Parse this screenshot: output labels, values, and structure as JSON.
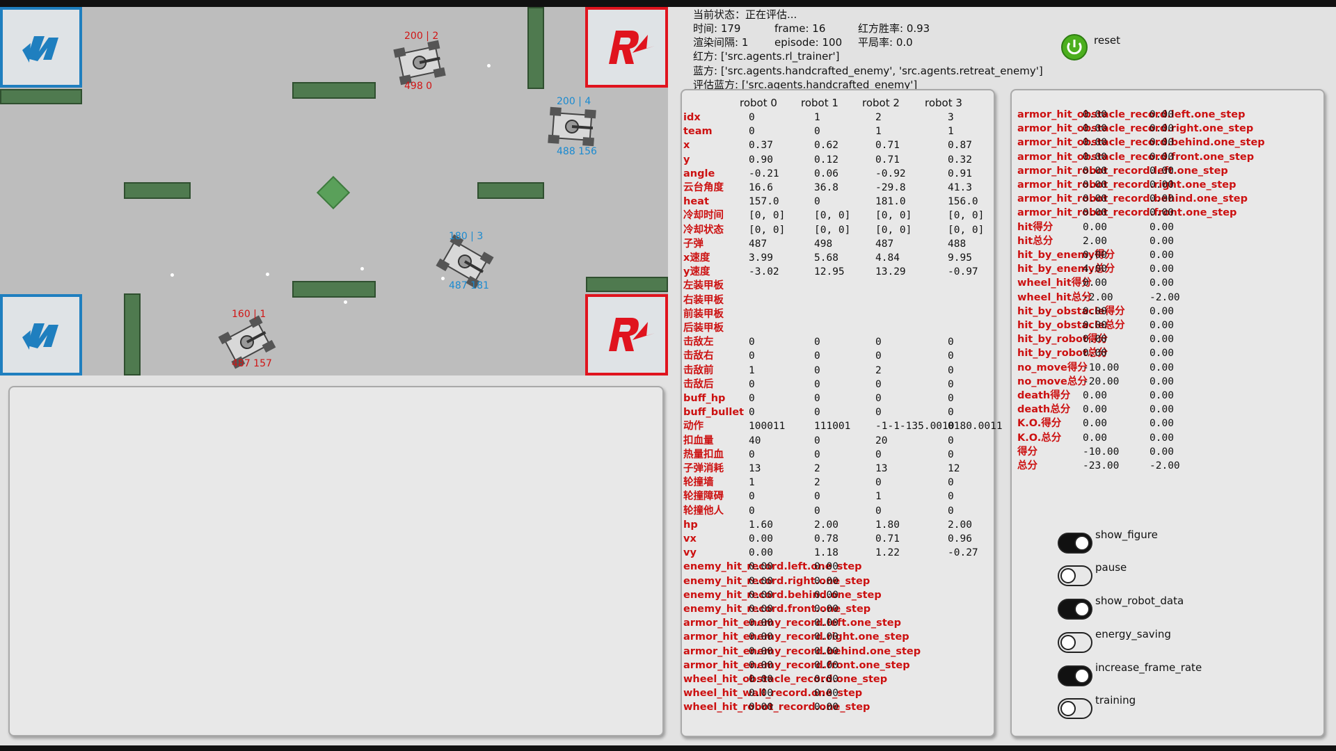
{
  "arena": {
    "robots": [
      {
        "id": "r0",
        "team": "red",
        "top_label": "200 | 2",
        "bottom_label": "498 0"
      },
      {
        "id": "r1",
        "team": "blue",
        "top_label": "200 | 4",
        "bottom_label": "488 156"
      },
      {
        "id": "r2",
        "team": "blue",
        "top_label": "180 | 3",
        "bottom_label": "487 181"
      },
      {
        "id": "r3",
        "team": "red",
        "top_label": "160 | 1",
        "bottom_label": "487 157"
      }
    ]
  },
  "status": {
    "line1": "当前状态：正在评估...",
    "time": "时间: 179",
    "frame": "frame: 16",
    "red_win": "红方胜率: 0.93",
    "render_interval": "渲染间隔: 1",
    "episode": "episode: 100",
    "draw_rate": "平局率: 0.0",
    "red_side": "红方: ['src.agents.rl_trainer']",
    "blue_side": "蓝方: ['src.agents.handcrafted_enemy', 'src.agents.retreat_enemy']",
    "eval_blue": "评估蓝方: ['src.agents.handcrafted_enemy']"
  },
  "reset_label": "reset",
  "colors": {
    "power_button": "#4caf1e",
    "red": "#cc1111",
    "blue": "#1a8ad0",
    "wall": "#4f7a4f"
  },
  "robot_table": {
    "headers": [
      "robot 0",
      "robot 1",
      "robot 2",
      "robot 3"
    ],
    "rows": [
      {
        "label": "idx",
        "v": [
          "0",
          "1",
          "2",
          "3"
        ]
      },
      {
        "label": "team",
        "v": [
          "0",
          "0",
          "1",
          "1"
        ]
      },
      {
        "label": "x",
        "v": [
          "0.37",
          "0.62",
          "0.71",
          "0.87"
        ]
      },
      {
        "label": "y",
        "v": [
          "0.90",
          "0.12",
          "0.71",
          "0.32"
        ]
      },
      {
        "label": "angle",
        "v": [
          "-0.21",
          "0.06",
          "-0.92",
          "0.91"
        ]
      },
      {
        "label": "云台角度",
        "v": [
          "16.6",
          "36.8",
          "-29.8",
          "41.3"
        ]
      },
      {
        "label": "heat",
        "v": [
          "157.0",
          "0",
          "181.0",
          "156.0"
        ]
      },
      {
        "label": "冷却时间",
        "v": [
          "[0, 0]",
          "[0, 0]",
          "[0, 0]",
          "[0, 0]"
        ]
      },
      {
        "label": "冷却状态",
        "v": [
          "[0, 0]",
          "[0, 0]",
          "[0, 0]",
          "[0, 0]"
        ]
      },
      {
        "label": "子弹",
        "v": [
          "487",
          "498",
          "487",
          "488"
        ]
      },
      {
        "label": "x速度",
        "v": [
          "3.99",
          "5.68",
          "4.84",
          "9.95"
        ]
      },
      {
        "label": "y速度",
        "v": [
          "-3.02",
          "12.95",
          "13.29",
          "-0.97"
        ]
      },
      {
        "label": "左装甲板",
        "v": [
          "",
          "",
          "",
          ""
        ]
      },
      {
        "label": "右装甲板",
        "v": [
          "",
          "",
          "",
          ""
        ]
      },
      {
        "label": "前装甲板",
        "v": [
          "",
          "",
          "",
          ""
        ]
      },
      {
        "label": "后装甲板",
        "v": [
          "",
          "",
          "",
          ""
        ]
      },
      {
        "label": "击敌左",
        "v": [
          "0",
          "0",
          "0",
          "0"
        ]
      },
      {
        "label": "击敌右",
        "v": [
          "0",
          "0",
          "0",
          "0"
        ]
      },
      {
        "label": "击敌前",
        "v": [
          "1",
          "0",
          "2",
          "0"
        ]
      },
      {
        "label": "击敌后",
        "v": [
          "0",
          "0",
          "0",
          "0"
        ]
      },
      {
        "label": "buff_hp",
        "v": [
          "0",
          "0",
          "0",
          "0"
        ]
      },
      {
        "label": "buff_bullet",
        "v": [
          "0",
          "0",
          "0",
          "0"
        ]
      },
      {
        "label": "动作",
        "v": [
          "100011",
          "111001",
          "-1-1-135.0010",
          "0180.0011"
        ]
      },
      {
        "label": "扣血量",
        "v": [
          "40",
          "0",
          "20",
          "0"
        ]
      },
      {
        "label": "热量扣血",
        "v": [
          "0",
          "0",
          "0",
          "0"
        ]
      },
      {
        "label": "子弹消耗",
        "v": [
          "13",
          "2",
          "13",
          "12"
        ]
      },
      {
        "label": "轮撞墙",
        "v": [
          "1",
          "2",
          "0",
          "0"
        ]
      },
      {
        "label": "轮撞障碍",
        "v": [
          "0",
          "0",
          "1",
          "0"
        ]
      },
      {
        "label": "轮撞他人",
        "v": [
          "0",
          "0",
          "0",
          "0"
        ]
      },
      {
        "label": "hp",
        "v": [
          "1.60",
          "2.00",
          "1.80",
          "2.00"
        ]
      },
      {
        "label": "vx",
        "v": [
          "0.00",
          "0.78",
          "0.71",
          "0.96"
        ]
      },
      {
        "label": "vy",
        "v": [
          "0.00",
          "1.18",
          "1.22",
          "-0.27"
        ]
      },
      {
        "label": "enemy_hit_record.left.one_step",
        "v": [
          "0.00",
          "0.00"
        ]
      },
      {
        "label": "enemy_hit_record.right.one_step",
        "v": [
          "0.00",
          "0.00"
        ]
      },
      {
        "label": "enemy_hit_record.behind.one_step",
        "v": [
          "0.00",
          "0.00"
        ]
      },
      {
        "label": "enemy_hit_record.front.one_step",
        "v": [
          "0.00",
          "0.00"
        ]
      },
      {
        "label": "armor_hit_enemy_record.left.one_step",
        "v": [
          "0.00",
          "0.00"
        ]
      },
      {
        "label": "armor_hit_enemy_record.right.one_step",
        "v": [
          "0.00",
          "0.00"
        ]
      },
      {
        "label": "armor_hit_enemy_record.behind.one_step",
        "v": [
          "0.00",
          "0.00"
        ]
      },
      {
        "label": "armor_hit_enemy_record.front.one_step",
        "v": [
          "0.00",
          "0.00"
        ]
      },
      {
        "label": "wheel_hit_obstacle_record.one_step",
        "v": [
          "0.00",
          "0.00"
        ]
      },
      {
        "label": "wheel_hit_wall_record.one_step",
        "v": [
          "0.00",
          "0.00"
        ]
      },
      {
        "label": "wheel_hit_robot_record.one_step",
        "v": [
          "0.00",
          "0.00"
        ]
      }
    ]
  },
  "reward_table": {
    "rows": [
      {
        "label": "armor_hit_obstacle_record.left.one_step",
        "v": [
          "0.00",
          "0.00"
        ]
      },
      {
        "label": "armor_hit_obstacle_record.right.one_step",
        "v": [
          "0.00",
          "0.00"
        ]
      },
      {
        "label": "armor_hit_obstacle_record.behind.one_step",
        "v": [
          "0.00",
          "0.00"
        ]
      },
      {
        "label": "armor_hit_obstacle_record.front.one_step",
        "v": [
          "0.00",
          "0.00"
        ]
      },
      {
        "label": "armor_hit_robot_record.left.one_step",
        "v": [
          "0.00",
          "0.00"
        ]
      },
      {
        "label": "armor_hit_robot_record.right.one_step",
        "v": [
          "0.00",
          "0.00"
        ]
      },
      {
        "label": "armor_hit_robot_record.behind.one_step",
        "v": [
          "0.00",
          "0.00"
        ]
      },
      {
        "label": "armor_hit_robot_record.front.one_step",
        "v": [
          "0.00",
          "0.00"
        ]
      },
      {
        "label": "hit得分",
        "v": [
          "0.00",
          "0.00"
        ]
      },
      {
        "label": "hit总分",
        "v": [
          "2.00",
          "0.00"
        ]
      },
      {
        "label": "hit_by_enemy得分",
        "v": [
          "0.00",
          "0.00"
        ]
      },
      {
        "label": "hit_by_enemy总分",
        "v": [
          "4.00",
          "0.00"
        ]
      },
      {
        "label": "wheel_hit得分",
        "v": [
          "0.00",
          "0.00"
        ]
      },
      {
        "label": "wheel_hit总分",
        "v": [
          "-2.00",
          "-2.00"
        ]
      },
      {
        "label": "hit_by_obstacle得分",
        "v": [
          "0.00",
          "0.00"
        ]
      },
      {
        "label": "hit_by_obstacle总分",
        "v": [
          "0.00",
          "0.00"
        ]
      },
      {
        "label": "hit_by_robot得分",
        "v": [
          "0.00",
          "0.00"
        ]
      },
      {
        "label": "hit_by_robot总分",
        "v": [
          "0.00",
          "0.00"
        ]
      },
      {
        "label": "no_move得分",
        "v": [
          "-10.00",
          "0.00"
        ]
      },
      {
        "label": "no_move总分",
        "v": [
          "-20.00",
          "0.00"
        ]
      },
      {
        "label": "death得分",
        "v": [
          "0.00",
          "0.00"
        ]
      },
      {
        "label": "death总分",
        "v": [
          "0.00",
          "0.00"
        ]
      },
      {
        "label": "K.O.得分",
        "v": [
          "0.00",
          "0.00"
        ]
      },
      {
        "label": "K.O.总分",
        "v": [
          "0.00",
          "0.00"
        ]
      },
      {
        "label": "得分",
        "v": [
          "-10.00",
          "0.00"
        ]
      },
      {
        "label": "总分",
        "v": [
          "-23.00",
          "-2.00"
        ]
      }
    ]
  },
  "toggles": [
    {
      "label": "show_figure",
      "on": true
    },
    {
      "label": "pause",
      "on": false
    },
    {
      "label": "show_robot_data",
      "on": true
    },
    {
      "label": "energy_saving",
      "on": false
    },
    {
      "label": "increase_frame_rate",
      "on": true
    },
    {
      "label": "training",
      "on": false
    }
  ]
}
